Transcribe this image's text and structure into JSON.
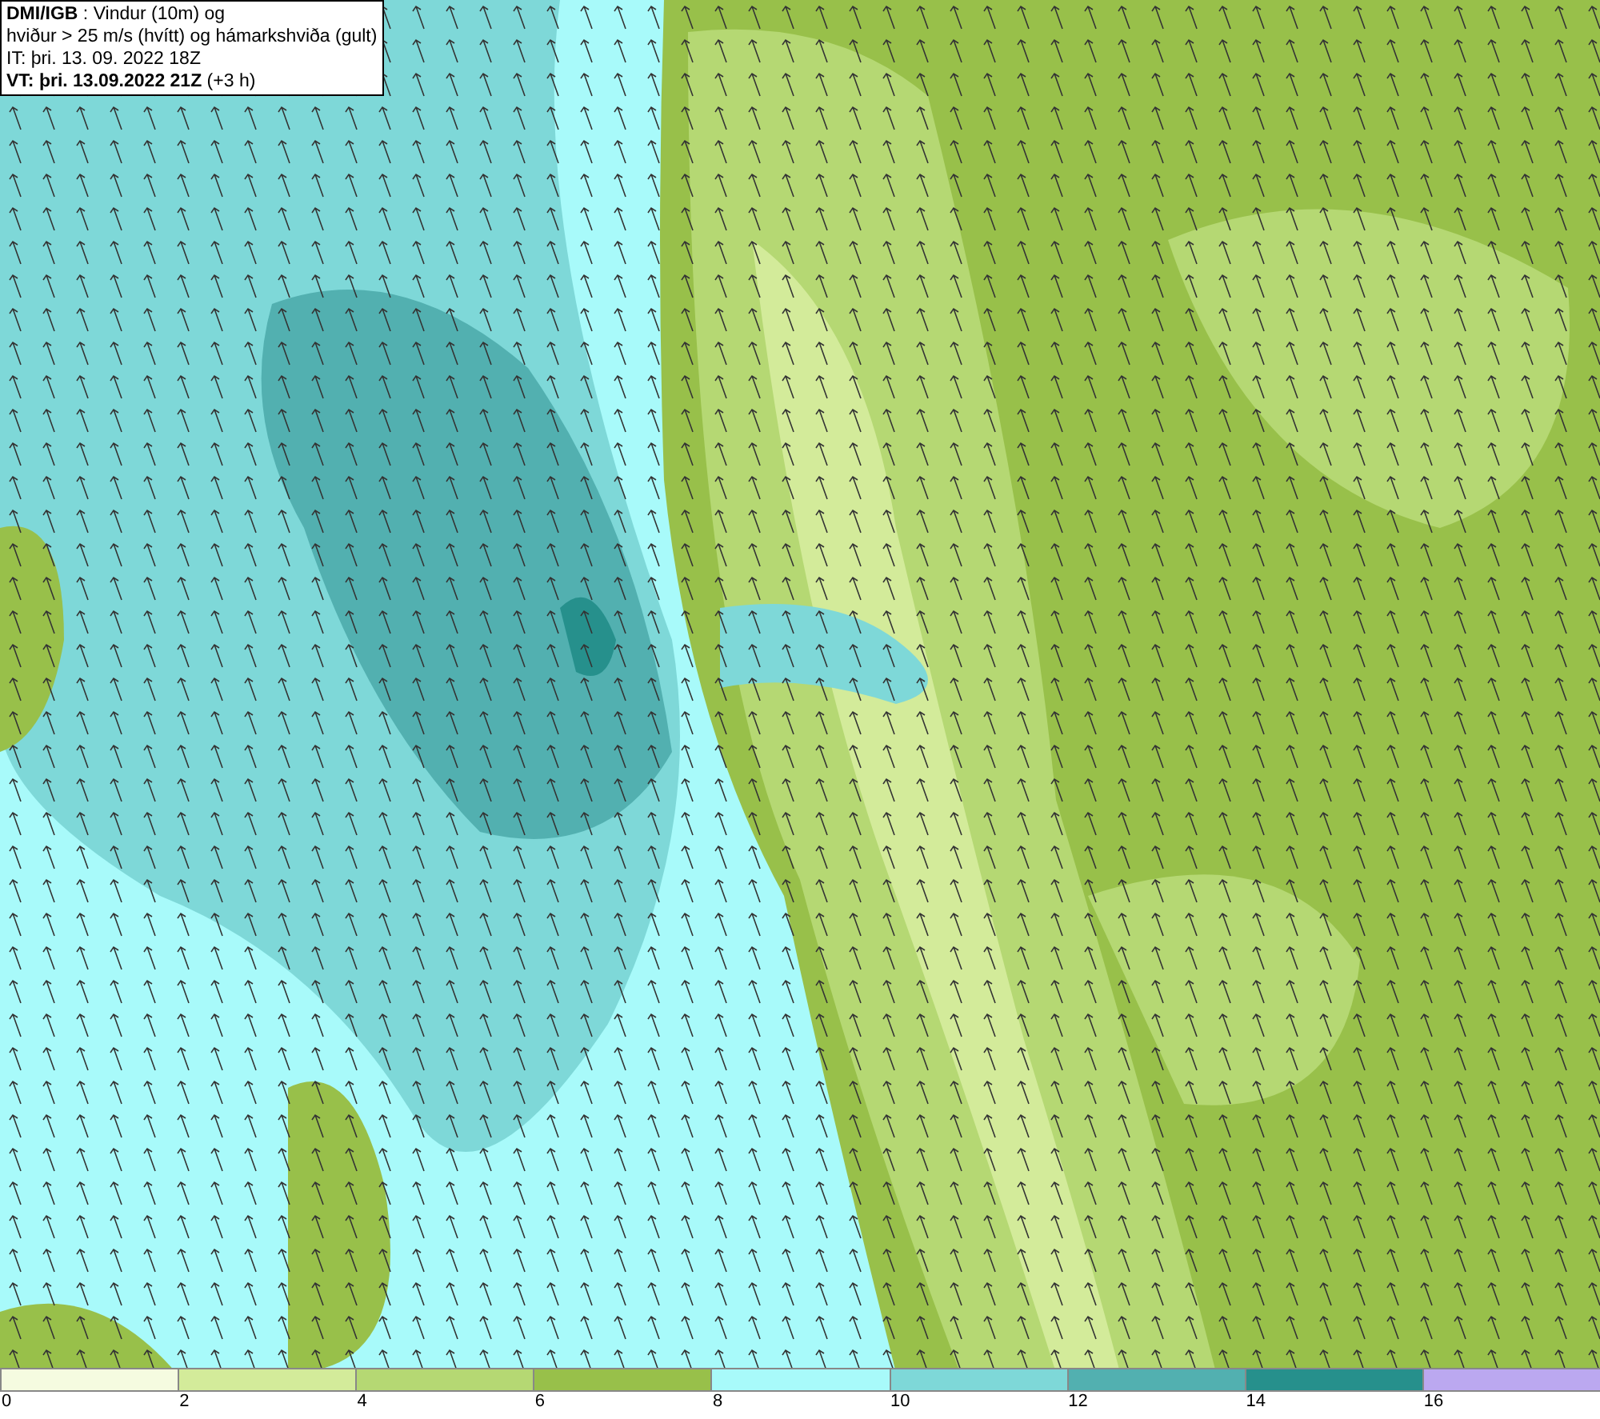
{
  "title_box": {
    "lines": [
      "**DMI/IGB** : Vindur (10m) og",
      "hviður > 25 m/s (hvítt) og hámarkshviða (gult)",
      "IT: þri. 13. 09. 2022 18Z",
      "**VT: þri. 13.09.2022 21Z** (+3 h)"
    ]
  },
  "legend": [
    {
      "label": "0",
      "color": "#f5fbe0"
    },
    {
      "label": "2",
      "color": "#d3eb9a"
    },
    {
      "label": "4",
      "color": "#b5d873"
    },
    {
      "label": "6",
      "color": "#98c04a"
    },
    {
      "label": "8",
      "color": "#a8fafa"
    },
    {
      "label": "10",
      "color": "#7ed8d8"
    },
    {
      "label": "12",
      "color": "#52b0b0"
    },
    {
      "label": "14",
      "color": "#26908c"
    },
    {
      "label": "16",
      "color": "#bba8f0"
    }
  ]
}
